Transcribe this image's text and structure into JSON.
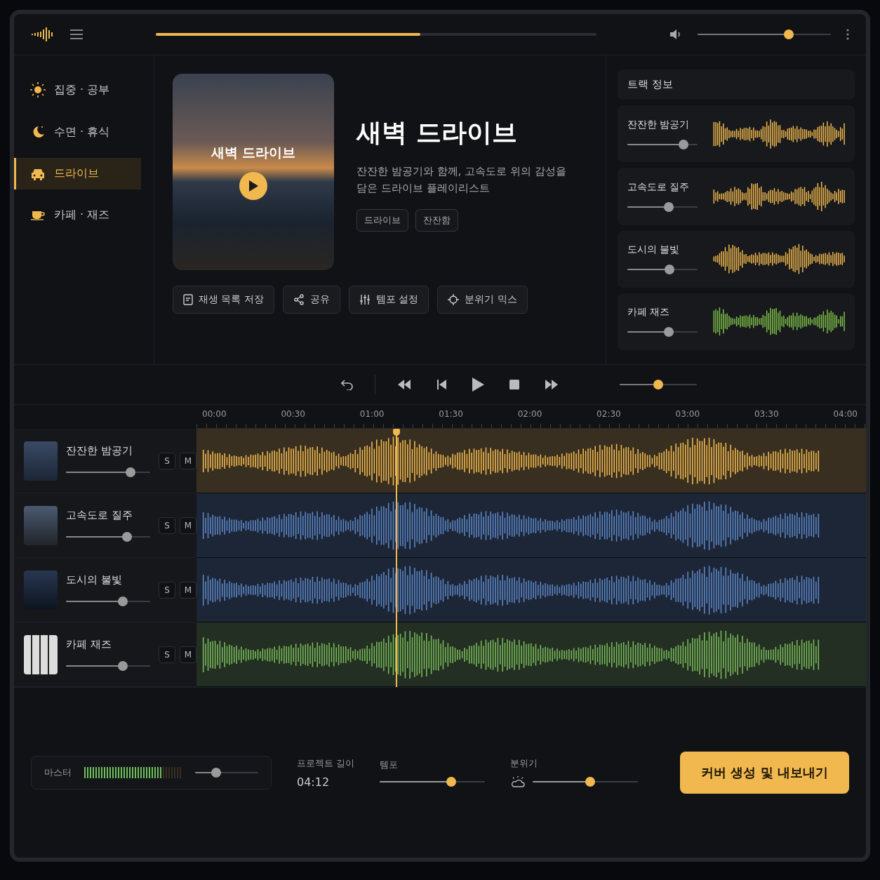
{
  "top_bar": {
    "progress": {
      "level": 0.6
    },
    "volume": {
      "level": 0.7
    }
  },
  "sidebar": {
    "items": [
      {
        "label": "집중 · 공부",
        "selected": false
      },
      {
        "label": "수면 · 휴식",
        "selected": false
      },
      {
        "label": "드라이브",
        "selected": true
      },
      {
        "label": "카페 · 재즈",
        "selected": false
      }
    ]
  },
  "hero": {
    "cover": {
      "title": "새벽 드라이브"
    },
    "title": "새벽 드라이브",
    "description": "잔잔한 밤공기와 함께, 고속도로 위의 감성을 담은 드라이브 플레이리스트",
    "tags": [
      "드라이브",
      "잔잔함"
    ],
    "actions": [
      "재생 목록 저장",
      "공유",
      "템포 설정",
      "분위기 믹스"
    ]
  },
  "right_panel": {
    "title": "트랙 정보",
    "tracks": [
      {
        "name": "잔잔한 밤공기",
        "level": 0.85,
        "color": "#f0b84e"
      },
      {
        "name": "고속도로 질주",
        "level": 0.6,
        "color": "#f0b84e"
      },
      {
        "name": "도시의 불빛",
        "level": 0.62,
        "color": "#f0b84e"
      },
      {
        "name": "카페 재즈",
        "level": 0.6,
        "color": "#7fbf4a"
      }
    ]
  },
  "transport": {
    "position": {
      "level": 0.5
    }
  },
  "editor": {
    "ruler": [
      "00:00",
      "00:30",
      "01:00",
      "01:30",
      "02:00",
      "02:30",
      "03:00",
      "03:30",
      "04:00"
    ],
    "playhead": {
      "level": 0.3
    },
    "tracks": [
      {
        "name": "잔잔한 밤공기",
        "level": 0.8,
        "color": "#f0b84e",
        "solo": {
          "label": "S",
          "on": false
        },
        "mute": {
          "label": "M",
          "on": false
        }
      },
      {
        "name": "고속도로 질주",
        "level": 0.75,
        "color": "#5b86c6",
        "solo": {
          "label": "S",
          "on": false
        },
        "mute": {
          "label": "M",
          "on": false
        }
      },
      {
        "name": "도시의 불빛",
        "level": 0.7,
        "color": "#5b86c6",
        "solo": {
          "label": "S",
          "on": false
        },
        "mute": {
          "label": "M",
          "on": false
        }
      },
      {
        "name": "카페 재즈",
        "level": 0.7,
        "color": "#78b85a",
        "solo": {
          "label": "S",
          "on": false
        },
        "mute": {
          "label": "M",
          "on": false
        }
      }
    ]
  },
  "bottom_bar": {
    "master": {
      "label": "마스터",
      "meter": {
        "level": 0.8
      },
      "volume": {
        "level": 0.3
      }
    },
    "project_length": {
      "label": "프로젝트 길이",
      "value": "04:12"
    },
    "tempo": {
      "label": "템포",
      "level": 0.7
    },
    "mood": {
      "label": "분위기",
      "level": 0.55
    },
    "export_button": "커버 생성 및 내보내기"
  }
}
